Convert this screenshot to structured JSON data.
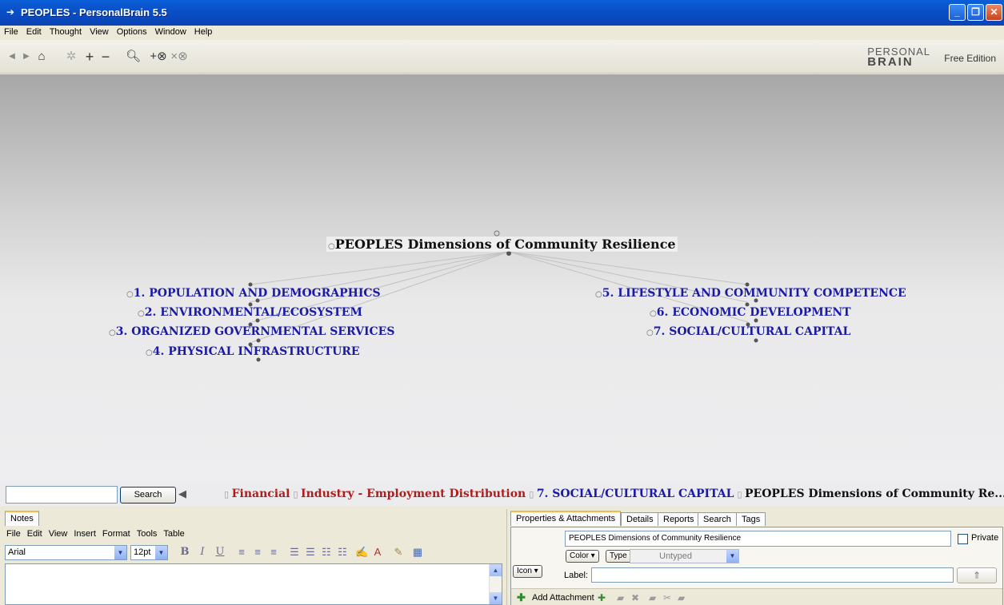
{
  "window": {
    "title": "PEOPLES - PersonalBrain 5.5"
  },
  "menu": [
    "File",
    "Edit",
    "Thought",
    "View",
    "Options",
    "Window",
    "Help"
  ],
  "toolbar": {
    "brand_top": "PERSONAL",
    "brand_bottom": "BRAIN",
    "edition": "Free Edition"
  },
  "plex": {
    "central": "PEOPLES Dimensions of Community Resilience",
    "left_children": [
      "1. POPULATION AND DEMOGRAPHICS",
      "2. ENVIRONMENTAL/ECOSYSTEM",
      "3. ORGANIZED GOVERNMENTAL SERVICES",
      "4. PHYSICAL INFRASTRUCTURE"
    ],
    "right_children": [
      "5. LIFESTYLE AND COMMUNITY COMPETENCE",
      "6. ECONOMIC DEVELOPMENT",
      "7. SOCIAL/CULTURAL CAPITAL"
    ]
  },
  "search": {
    "value": "",
    "button": "Search"
  },
  "breadcrumbs": [
    {
      "label": "Financial",
      "color": "#b01c1c"
    },
    {
      "label": "Industry - Employment Distribution",
      "color": "#b01c1c"
    },
    {
      "label": "7. SOCIAL/CULTURAL CAPITAL",
      "color": "#1a1aa6"
    },
    {
      "label": "PEOPLES Dimensions of Community Re...",
      "color": "#111111"
    }
  ],
  "notes": {
    "tab": "Notes",
    "menu": [
      "File",
      "Edit",
      "View",
      "Insert",
      "Format",
      "Tools",
      "Table"
    ],
    "font": "Arial",
    "size": "12pt",
    "content": ""
  },
  "properties": {
    "tabs": [
      "Properties & Attachments",
      "Details",
      "Reports",
      "Search",
      "Tags"
    ],
    "name": "PEOPLES Dimensions of Community Resilience",
    "private_label": "Private",
    "color_btn": "Color ▾",
    "type_btn": "Type ▾",
    "type_value": "Untyped",
    "icon_btn": "Icon ▾",
    "label_caption": "Label:",
    "label_value": "",
    "add_attachment": "Add Attachment"
  }
}
